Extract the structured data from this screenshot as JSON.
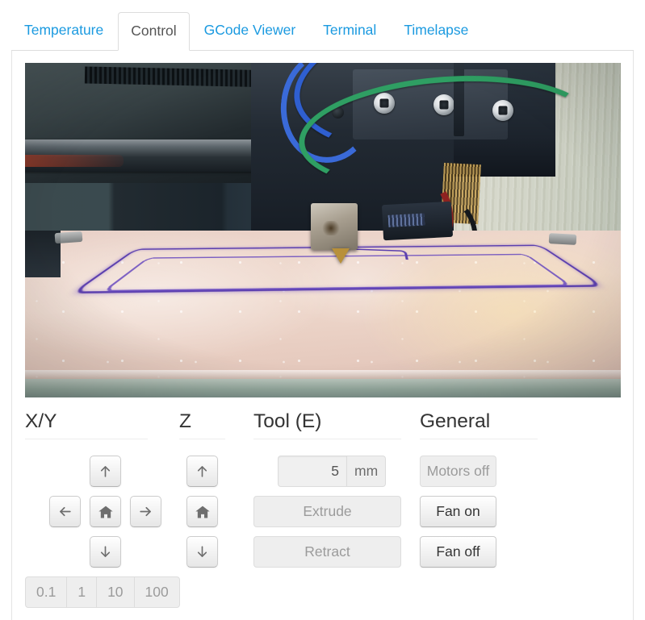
{
  "tabs": [
    {
      "label": "Temperature",
      "active": false
    },
    {
      "label": "Control",
      "active": true
    },
    {
      "label": "GCode Viewer",
      "active": false
    },
    {
      "label": "Terminal",
      "active": false
    },
    {
      "label": "Timelapse",
      "active": false
    }
  ],
  "webcam": {
    "alt": "Live webcam feed of 3D printer extruder printing a purple outline on the heated bed"
  },
  "controls": {
    "xy": {
      "title": "X/Y",
      "up_icon": "arrow-up-icon",
      "left_icon": "arrow-left-icon",
      "home_icon": "home-icon",
      "right_icon": "arrow-right-icon",
      "down_icon": "arrow-down-icon",
      "steps": [
        {
          "label": "0.1",
          "selected": false
        },
        {
          "label": "1",
          "selected": false
        },
        {
          "label": "10",
          "selected": false
        },
        {
          "label": "100",
          "selected": false
        }
      ]
    },
    "z": {
      "title": "Z",
      "up_icon": "arrow-up-icon",
      "home_icon": "home-icon",
      "down_icon": "arrow-down-icon"
    },
    "tool": {
      "title": "Tool (E)",
      "amount_value": "5",
      "amount_placeholder": "5",
      "unit_label": "mm",
      "extrude_label": "Extrude",
      "retract_label": "Retract",
      "extrude_disabled": true,
      "retract_disabled": true
    },
    "general": {
      "title": "General",
      "motors_off_label": "Motors off",
      "fan_on_label": "Fan on",
      "fan_off_label": "Fan off",
      "motors_off_disabled": true
    }
  },
  "colors": {
    "link_blue": "#1b9ae0",
    "active_tab_text": "#555555",
    "heading": "#333333",
    "disabled_text": "#9b9b9b",
    "border": "#dddddd",
    "button_face": "#f5f5f5",
    "print_purple": "#5b3fae"
  }
}
